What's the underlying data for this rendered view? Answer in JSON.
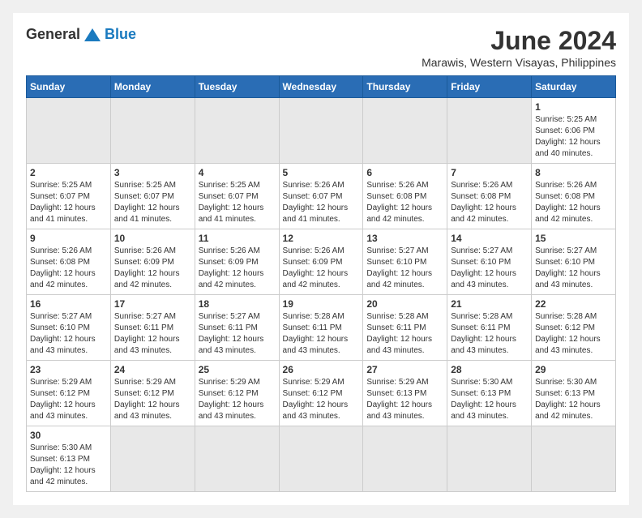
{
  "logo": {
    "text_general": "General",
    "text_blue": "Blue"
  },
  "header": {
    "month_title": "June 2024",
    "location": "Marawis, Western Visayas, Philippines"
  },
  "days_of_week": [
    "Sunday",
    "Monday",
    "Tuesday",
    "Wednesday",
    "Thursday",
    "Friday",
    "Saturday"
  ],
  "weeks": [
    [
      {
        "day": "",
        "info": ""
      },
      {
        "day": "",
        "info": ""
      },
      {
        "day": "",
        "info": ""
      },
      {
        "day": "",
        "info": ""
      },
      {
        "day": "",
        "info": ""
      },
      {
        "day": "",
        "info": ""
      },
      {
        "day": "1",
        "info": "Sunrise: 5:25 AM\nSunset: 6:06 PM\nDaylight: 12 hours and 40 minutes."
      }
    ],
    [
      {
        "day": "2",
        "info": "Sunrise: 5:25 AM\nSunset: 6:07 PM\nDaylight: 12 hours and 41 minutes."
      },
      {
        "day": "3",
        "info": "Sunrise: 5:25 AM\nSunset: 6:07 PM\nDaylight: 12 hours and 41 minutes."
      },
      {
        "day": "4",
        "info": "Sunrise: 5:25 AM\nSunset: 6:07 PM\nDaylight: 12 hours and 41 minutes."
      },
      {
        "day": "5",
        "info": "Sunrise: 5:26 AM\nSunset: 6:07 PM\nDaylight: 12 hours and 41 minutes."
      },
      {
        "day": "6",
        "info": "Sunrise: 5:26 AM\nSunset: 6:08 PM\nDaylight: 12 hours and 42 minutes."
      },
      {
        "day": "7",
        "info": "Sunrise: 5:26 AM\nSunset: 6:08 PM\nDaylight: 12 hours and 42 minutes."
      },
      {
        "day": "8",
        "info": "Sunrise: 5:26 AM\nSunset: 6:08 PM\nDaylight: 12 hours and 42 minutes."
      }
    ],
    [
      {
        "day": "9",
        "info": "Sunrise: 5:26 AM\nSunset: 6:08 PM\nDaylight: 12 hours and 42 minutes."
      },
      {
        "day": "10",
        "info": "Sunrise: 5:26 AM\nSunset: 6:09 PM\nDaylight: 12 hours and 42 minutes."
      },
      {
        "day": "11",
        "info": "Sunrise: 5:26 AM\nSunset: 6:09 PM\nDaylight: 12 hours and 42 minutes."
      },
      {
        "day": "12",
        "info": "Sunrise: 5:26 AM\nSunset: 6:09 PM\nDaylight: 12 hours and 42 minutes."
      },
      {
        "day": "13",
        "info": "Sunrise: 5:27 AM\nSunset: 6:10 PM\nDaylight: 12 hours and 42 minutes."
      },
      {
        "day": "14",
        "info": "Sunrise: 5:27 AM\nSunset: 6:10 PM\nDaylight: 12 hours and 43 minutes."
      },
      {
        "day": "15",
        "info": "Sunrise: 5:27 AM\nSunset: 6:10 PM\nDaylight: 12 hours and 43 minutes."
      }
    ],
    [
      {
        "day": "16",
        "info": "Sunrise: 5:27 AM\nSunset: 6:10 PM\nDaylight: 12 hours and 43 minutes."
      },
      {
        "day": "17",
        "info": "Sunrise: 5:27 AM\nSunset: 6:11 PM\nDaylight: 12 hours and 43 minutes."
      },
      {
        "day": "18",
        "info": "Sunrise: 5:27 AM\nSunset: 6:11 PM\nDaylight: 12 hours and 43 minutes."
      },
      {
        "day": "19",
        "info": "Sunrise: 5:28 AM\nSunset: 6:11 PM\nDaylight: 12 hours and 43 minutes."
      },
      {
        "day": "20",
        "info": "Sunrise: 5:28 AM\nSunset: 6:11 PM\nDaylight: 12 hours and 43 minutes."
      },
      {
        "day": "21",
        "info": "Sunrise: 5:28 AM\nSunset: 6:11 PM\nDaylight: 12 hours and 43 minutes."
      },
      {
        "day": "22",
        "info": "Sunrise: 5:28 AM\nSunset: 6:12 PM\nDaylight: 12 hours and 43 minutes."
      }
    ],
    [
      {
        "day": "23",
        "info": "Sunrise: 5:29 AM\nSunset: 6:12 PM\nDaylight: 12 hours and 43 minutes."
      },
      {
        "day": "24",
        "info": "Sunrise: 5:29 AM\nSunset: 6:12 PM\nDaylight: 12 hours and 43 minutes."
      },
      {
        "day": "25",
        "info": "Sunrise: 5:29 AM\nSunset: 6:12 PM\nDaylight: 12 hours and 43 minutes."
      },
      {
        "day": "26",
        "info": "Sunrise: 5:29 AM\nSunset: 6:12 PM\nDaylight: 12 hours and 43 minutes."
      },
      {
        "day": "27",
        "info": "Sunrise: 5:29 AM\nSunset: 6:13 PM\nDaylight: 12 hours and 43 minutes."
      },
      {
        "day": "28",
        "info": "Sunrise: 5:30 AM\nSunset: 6:13 PM\nDaylight: 12 hours and 43 minutes."
      },
      {
        "day": "29",
        "info": "Sunrise: 5:30 AM\nSunset: 6:13 PM\nDaylight: 12 hours and 42 minutes."
      }
    ],
    [
      {
        "day": "30",
        "info": "Sunrise: 5:30 AM\nSunset: 6:13 PM\nDaylight: 12 hours and 42 minutes."
      },
      {
        "day": "",
        "info": ""
      },
      {
        "day": "",
        "info": ""
      },
      {
        "day": "",
        "info": ""
      },
      {
        "day": "",
        "info": ""
      },
      {
        "day": "",
        "info": ""
      },
      {
        "day": "",
        "info": ""
      }
    ]
  ]
}
